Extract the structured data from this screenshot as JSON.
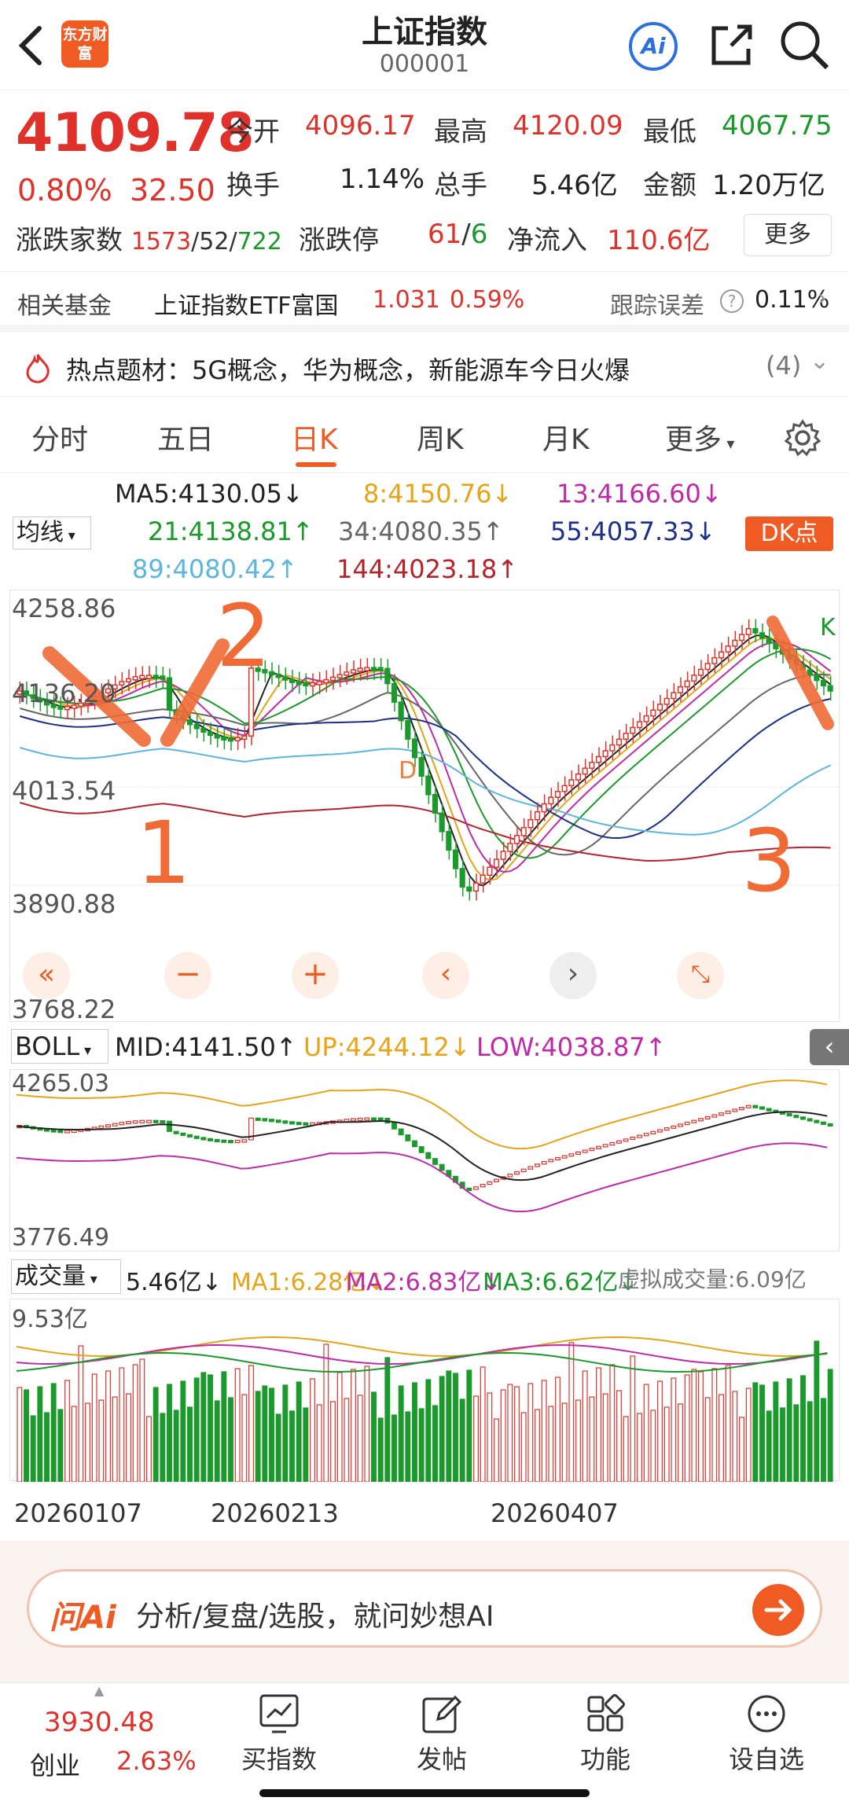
{
  "header": {
    "title": "上证指数",
    "code": "000001",
    "logo": "东方财富",
    "ai": "Ai"
  },
  "quote": {
    "price": "4109.78",
    "pct": "0.80%",
    "chg": "32.50",
    "open_l": "今开",
    "open": "4096.17",
    "high_l": "最高",
    "high": "4120.09",
    "low_l": "最低",
    "low": "4067.75",
    "turn_l": "换手",
    "turn": "1.14%",
    "vol_l": "总手",
    "vol": "5.46亿",
    "amt_l": "金额",
    "amt": "1.20万亿",
    "adv_l": "涨跌家数",
    "adv_up": "1573",
    "adv_flat": "52",
    "adv_dn": "722",
    "limit_l": "涨跌停",
    "limit_up": "61",
    "limit_dn": "6",
    "flow_l": "净流入",
    "flow": "110.6亿",
    "more": "更多"
  },
  "fund": {
    "label": "相关基金",
    "name": "上证指数ETF富国",
    "price": "1.031",
    "pct": "0.59%",
    "err_l": "跟踪误差",
    "err": "0.11%"
  },
  "hot": {
    "text": "热点题材：5G概念，华为概念，新能源车今日火爆",
    "count": "(4)"
  },
  "tabs": [
    "分时",
    "五日",
    "日K",
    "周K",
    "月K",
    "更多"
  ],
  "ma": {
    "select": "均线",
    "dk": "DK点",
    "ma5": "MA5:4130.05↓",
    "ma8": "8:4150.76↓",
    "ma13": "13:4166.60↓",
    "ma21": "21:4138.81↑",
    "ma34": "34:4080.35↑",
    "ma55": "55:4057.33↓",
    "ma89": "89:4080.42↑",
    "ma144": "144:4023.18↑"
  },
  "kaxis": [
    "4258.86",
    "4136.20",
    "4013.54",
    "3890.88",
    "3768.22"
  ],
  "boll": {
    "select": "BOLL",
    "mid": "MID:4141.50↑",
    "up": "UP:4244.12↓",
    "low": "LOW:4038.87↑",
    "top": "4265.03",
    "bottom": "3776.49"
  },
  "volbar": {
    "select": "成交量",
    "cur": "5.46亿↓",
    "ma1": "MA1:6.28亿↓",
    "ma2": "MA2:6.83亿↓",
    "ma3": "MA3:6.62亿↓",
    "virt": "虚拟成交量:6.09亿",
    "top": "9.53亿"
  },
  "dates": [
    "20260107",
    "20260213",
    "20260407"
  ],
  "annot": {
    "n1": "1",
    "n2": "2",
    "n3": "3",
    "mark_d": "D",
    "mark_k": "K"
  },
  "ai": {
    "logo": "问Ai",
    "placeholder": "分析/复盘/选股，就问妙想AI"
  },
  "bottom": {
    "cy_price": "3930.48",
    "cy_name": "创业",
    "cy_pct": "2.63%",
    "b1": "买指数",
    "b2": "发帖",
    "b3": "功能",
    "b4": "设自选"
  },
  "colors": {
    "up": "#e0322b",
    "down": "#1a9a2a",
    "accent": "#f05a23"
  }
}
